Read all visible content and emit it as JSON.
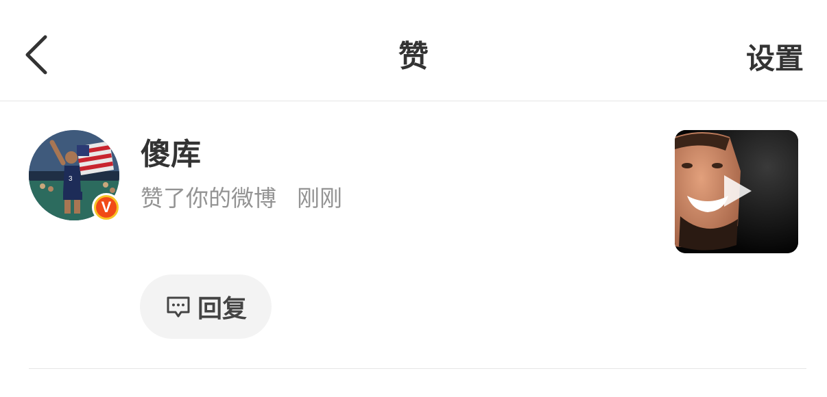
{
  "header": {
    "title": "赞",
    "settings_label": "设置",
    "back_icon": "chevron-left-icon"
  },
  "notification": {
    "username": "傻库",
    "action_text": "赞了你的微博",
    "time": "刚刚",
    "verified_badge": "V",
    "reply_label": "回复",
    "reply_icon": "comment-icon",
    "thumbnail_overlay_icon": "play-icon"
  },
  "colors": {
    "text_primary": "#333333",
    "text_secondary": "#939393",
    "divider": "#e6e6e6",
    "badge_outer": "#f7c325",
    "badge_inner": "#f14a16",
    "reply_bg": "#f3f3f3"
  }
}
